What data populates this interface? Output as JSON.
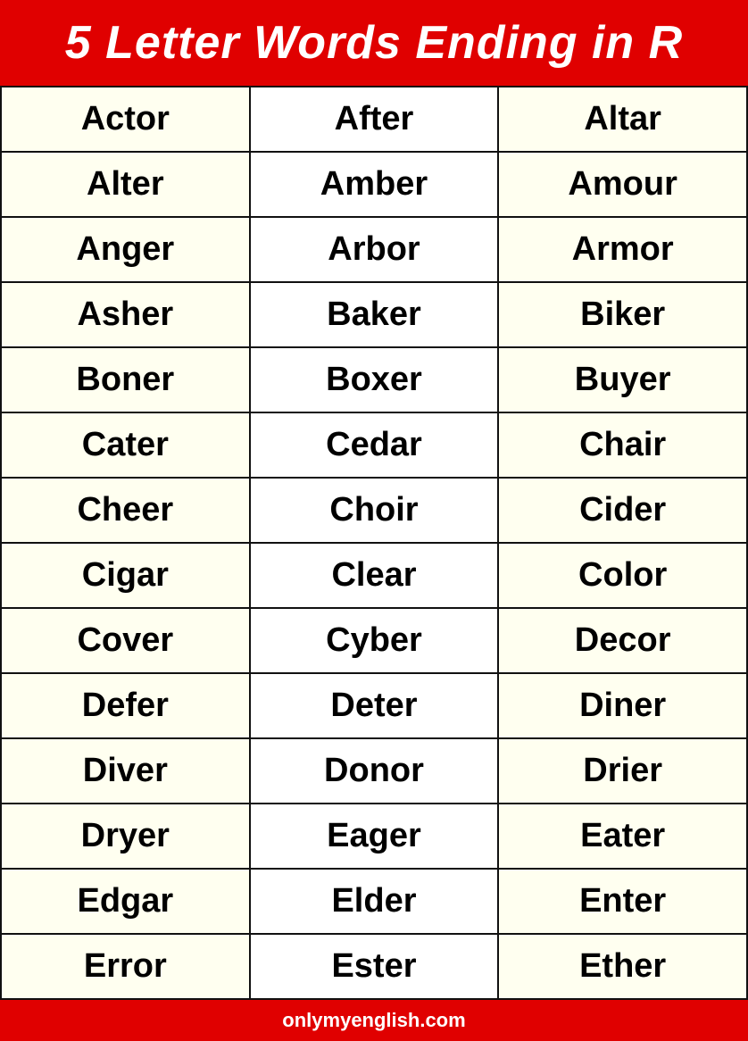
{
  "header": {
    "title": "5 Letter Words Ending in R"
  },
  "words": [
    [
      "Actor",
      "After",
      "Altar"
    ],
    [
      "Alter",
      "Amber",
      "Amour"
    ],
    [
      "Anger",
      "Arbor",
      "Armor"
    ],
    [
      "Asher",
      "Baker",
      "Biker"
    ],
    [
      "Boner",
      "Boxer",
      "Buyer"
    ],
    [
      "Cater",
      "Cedar",
      "Chair"
    ],
    [
      "Cheer",
      "Choir",
      "Cider"
    ],
    [
      "Cigar",
      "Clear",
      "Color"
    ],
    [
      "Cover",
      "Cyber",
      "Decor"
    ],
    [
      "Defer",
      "Deter",
      "Diner"
    ],
    [
      "Diver",
      "Donor",
      "Drier"
    ],
    [
      "Dryer",
      "Eager",
      "Eater"
    ],
    [
      "Edgar",
      "Elder",
      "Enter"
    ],
    [
      "Error",
      "Ester",
      "Ether"
    ]
  ],
  "footer": {
    "url": "onlymyenglish.com"
  }
}
